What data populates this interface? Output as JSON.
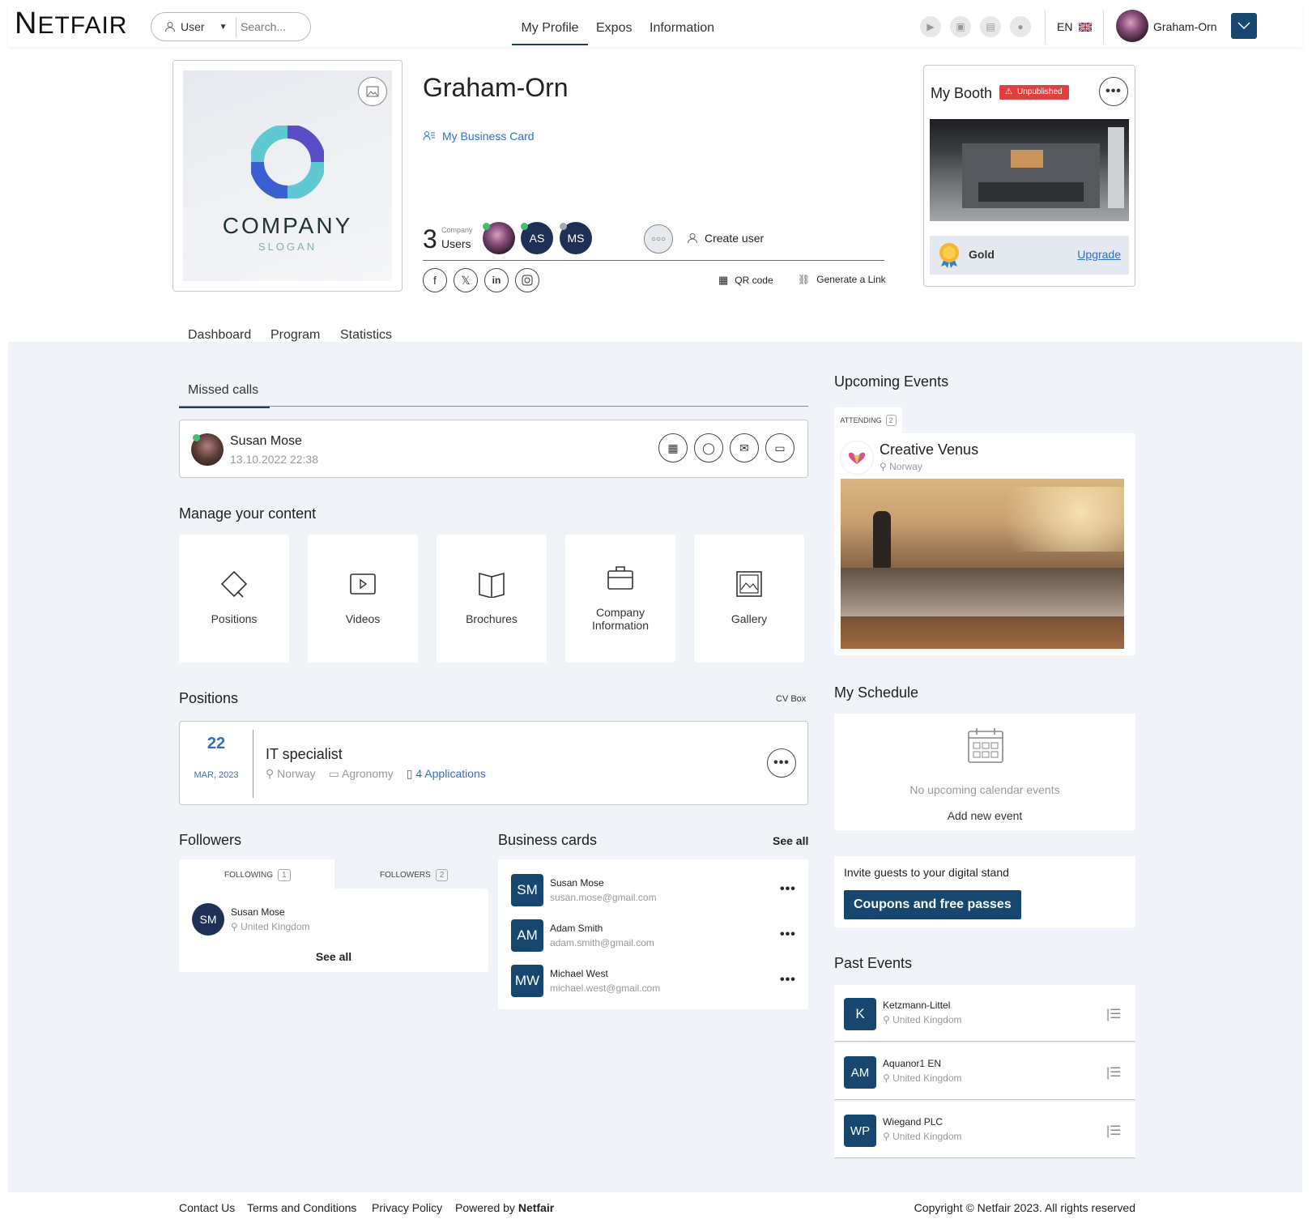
{
  "header": {
    "logo_n": "N",
    "logo_rest": "ETFAIR",
    "search_user": "User",
    "search_placeholder": "Search...",
    "nav": [
      "My Profile",
      "Expos",
      "Information"
    ],
    "lang": "EN",
    "user_name": "Graham-Orn"
  },
  "profile": {
    "company_word": "COMPANY",
    "company_slogan": "SLOGAN",
    "name": "Graham-Orn",
    "business_card": "My Business Card",
    "users_count": "3",
    "users_small": "Company",
    "users_label": "Users",
    "avatars": [
      "AS",
      "MS"
    ],
    "create_user": "Create user",
    "qr_code": "QR code",
    "generate_link": "Generate a Link"
  },
  "booth": {
    "title": "My Booth",
    "status": "Unpublished",
    "tier": "Gold",
    "upgrade": "Upgrade"
  },
  "tabs": [
    "Dashboard",
    "Program",
    "Statistics"
  ],
  "missed_calls": {
    "tab": "Missed calls",
    "name": "Susan Mose",
    "date": "13.10.2022 22:38"
  },
  "manage": {
    "title": "Manage your content",
    "tiles": [
      "Positions",
      "Videos",
      "Brochures",
      "Company\nInformation",
      "Gallery"
    ]
  },
  "positions": {
    "title": "Positions",
    "cv_box": "CV Box",
    "day": "22",
    "month": "MAR, 2023",
    "role": "IT specialist",
    "location": "Norway",
    "industry": "Agronomy",
    "applications": "4 Applications"
  },
  "followers": {
    "title": "Followers",
    "tab_following": "FOLLOWING",
    "following_count": "1",
    "tab_followers": "FOLLOWERS",
    "followers_count": "2",
    "initials": "SM",
    "name": "Susan Mose",
    "country": "United Kingdom",
    "see_all": "See all"
  },
  "business_cards": {
    "title": "Business cards",
    "see_all": "See all",
    "items": [
      {
        "initials": "SM",
        "name": "Susan Mose",
        "email": "susan.mose@gmail.com"
      },
      {
        "initials": "AM",
        "name": "Adam Smith",
        "email": "adam.smith@gmail.com"
      },
      {
        "initials": "MW",
        "name": "Michael West",
        "email": "michael.west@gmail.com"
      }
    ]
  },
  "upcoming": {
    "title": "Upcoming Events",
    "tab": "ATTENDING",
    "count": "2",
    "event_name": "Creative Venus",
    "event_location": "Norway"
  },
  "schedule": {
    "title": "My Schedule",
    "empty": "No upcoming calendar events",
    "add": "Add new event"
  },
  "invite": {
    "text": "Invite guests to your digital stand",
    "button": "Coupons and free passes"
  },
  "past": {
    "title": "Past Events",
    "items": [
      {
        "initials": "K",
        "name": "Ketzmann-Littel",
        "country": "United Kingdom"
      },
      {
        "initials": "AM",
        "name": "Aquanor1 EN",
        "country": "United Kingdom"
      },
      {
        "initials": "WP",
        "name": "Wiegand PLC",
        "country": "United Kingdom"
      }
    ]
  },
  "footer": {
    "links": [
      "Contact Us",
      "Terms and Conditions",
      "Privacy Policy"
    ],
    "powered": "Powered by",
    "brand": "Netfair",
    "copyright": "Copyright © Netfair 2023. All rights reserved"
  },
  "colors": {
    "primary": "#17466f",
    "accent": "#2f6fc2",
    "unpublished": "#e04040",
    "online": "#3fbf6f"
  }
}
